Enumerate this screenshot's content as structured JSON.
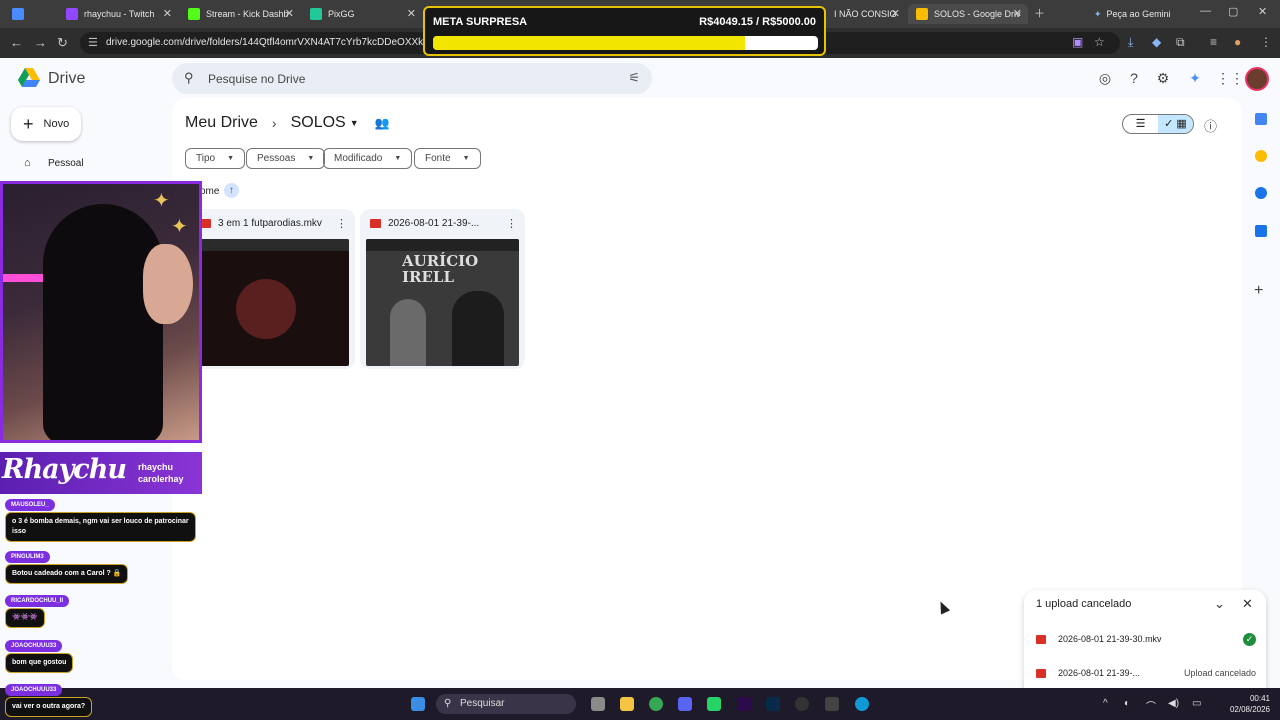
{
  "browser": {
    "tabs": [
      {
        "label": "",
        "color": "#4a8cff"
      },
      {
        "label": "rhaychuu - Twitch",
        "color": "#9146ff"
      },
      {
        "label": "Stream - Kick Dashb",
        "color": "#53fc18"
      },
      {
        "label": "PixGG",
        "color": "#20c997"
      },
      {
        "label": "I NÃO CONSIG",
        "color": "#ff4444"
      },
      {
        "label": "SOLOS - Google Driv",
        "color": "#fbbc04"
      }
    ],
    "gemini_label": "Peça ao Gemini",
    "url": "drive.google.com/drive/folders/144Qtfl4omrVXN4AT7cYrb7kcDDeOXXk1"
  },
  "goal": {
    "title": "META SURPRESA",
    "amount_text": "R$4049.15 / R$5000.00",
    "progress": 0.81,
    "fill_color": "#f2e600",
    "border_color": "#e6c200"
  },
  "drive": {
    "app_name": "Drive",
    "search_placeholder": "Pesquise no Drive",
    "new_label": "Novo",
    "sidebar_item": "Pessoal",
    "breadcrumb_root": "Meu Drive",
    "breadcrumb_current": "SOLOS",
    "filters": [
      "Tipo",
      "Pessoas",
      "Modificado",
      "Fonte"
    ],
    "sort_label": "ome",
    "files": [
      {
        "name": "3 em 1 futparodias.mkv"
      },
      {
        "name": "2026-08-01 21-39-..."
      }
    ],
    "thumb2_text": "AURÍCIO\nIRELL",
    "upload_panel": {
      "title": "1 upload cancelado",
      "items": [
        {
          "name": "2026-08-01 21-39-30.mkv",
          "status": ""
        },
        {
          "name": "2026-08-01 21-39-...",
          "status": "Upload cancelado"
        }
      ]
    }
  },
  "stream": {
    "brand_name": "Rhaychu",
    "handles": [
      "rhaychu",
      "carolerhay"
    ],
    "chat": [
      {
        "user": "MAUSOLEU_",
        "message": "o 3 é bomba demais, ngm vai ser louco de patrocinar\nisso"
      },
      {
        "user": "PINGULIM3",
        "message": "Botou cadeado com a Carol ? 🔒"
      },
      {
        "user": "RICARDOCHUU_II",
        "message": "👾👾👾"
      },
      {
        "user": "JOAOCHUUU33",
        "message": "bom que gostou"
      },
      {
        "user": "JOAOCHUUU33",
        "message": "vai ver o outra agora?"
      }
    ]
  },
  "taskbar": {
    "search_label": "Pesquisar",
    "time": "00:41",
    "date": "02/08/2026"
  }
}
